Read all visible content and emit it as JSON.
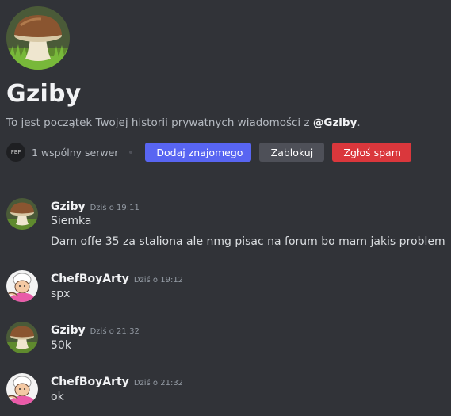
{
  "profile": {
    "name": "Gziby",
    "intro_prefix": "To jest początek Twojej historii prywatnych wiadomości z ",
    "intro_mention": "@Gziby",
    "intro_suffix": ".",
    "server_icon_text": "FBF",
    "mutual_servers": "1 wspólny serwer",
    "add_friend_label": "Dodaj znajomego",
    "block_label": "Zablokuj",
    "report_label": "Zgłoś spam",
    "colors": {
      "primary": "#5865f2",
      "danger": "#da373c",
      "secondary": "#4e5058"
    }
  },
  "messages": [
    {
      "author": "Gziby",
      "time": "Dziś o 19:11",
      "lines": [
        "Siemka",
        "Dam offe 35 za staliona ale nmg pisac na forum bo mam jakis problem"
      ],
      "avatar": "mushroom-avatar"
    },
    {
      "author": "ChefBoyArty",
      "time": "Dziś o 19:12",
      "lines": [
        "spx"
      ],
      "avatar": "chef-avatar"
    },
    {
      "author": "Gziby",
      "time": "Dziś o 21:32",
      "lines": [
        "50k"
      ],
      "avatar": "mushroom-avatar"
    },
    {
      "author": "ChefBoyArty",
      "time": "Dziś o 21:32",
      "lines": [
        "ok"
      ],
      "avatar": "chef-avatar"
    }
  ]
}
